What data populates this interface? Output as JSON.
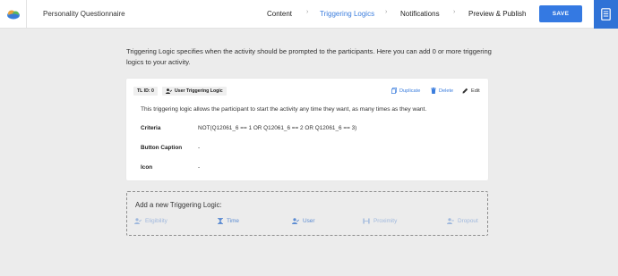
{
  "header": {
    "title": "Personality Questionnaire",
    "nav": [
      {
        "label": "Content",
        "active": false
      },
      {
        "label": "Triggering Logics",
        "active": true
      },
      {
        "label": "Notifications",
        "active": false
      },
      {
        "label": "Preview & Publish",
        "active": false
      }
    ],
    "separator": "›",
    "save_label": "SAVE",
    "logo_icon": "cloud-logo-icon",
    "side_icon": "document-icon"
  },
  "intro": "Triggering Logic specifies when the activity should be prompted to the participants. Here you can add 0 or more triggering logics to your activity.",
  "card": {
    "id_tag": "TL ID: 0",
    "type_tag": "User Triggering Logic",
    "actions": {
      "duplicate": "Duplicate",
      "delete": "Delete",
      "edit": "Edit"
    },
    "description": "This triggering logic allows the participant to start the activity any time they want, as many times as they want.",
    "rows": [
      {
        "label": "Criteria",
        "value": "NOT(Q12061_6 == 1 OR Q12061_6 == 2 OR Q12061_6 == 3)"
      },
      {
        "label": "Button Caption",
        "value": "-"
      },
      {
        "label": "Icon",
        "value": "-"
      }
    ]
  },
  "add": {
    "title": "Add a new Triggering Logic:",
    "options": [
      {
        "label": "Eligibility",
        "icon": "user-check-icon"
      },
      {
        "label": "Time",
        "icon": "hourglass-icon"
      },
      {
        "label": "User",
        "icon": "user-icon"
      },
      {
        "label": "Proximity",
        "icon": "proximity-icon"
      },
      {
        "label": "Dropout",
        "icon": "user-minus-icon"
      }
    ]
  },
  "colors": {
    "accent": "#3479e2",
    "active_nav": "#3b7ddd",
    "background": "#ececec"
  }
}
